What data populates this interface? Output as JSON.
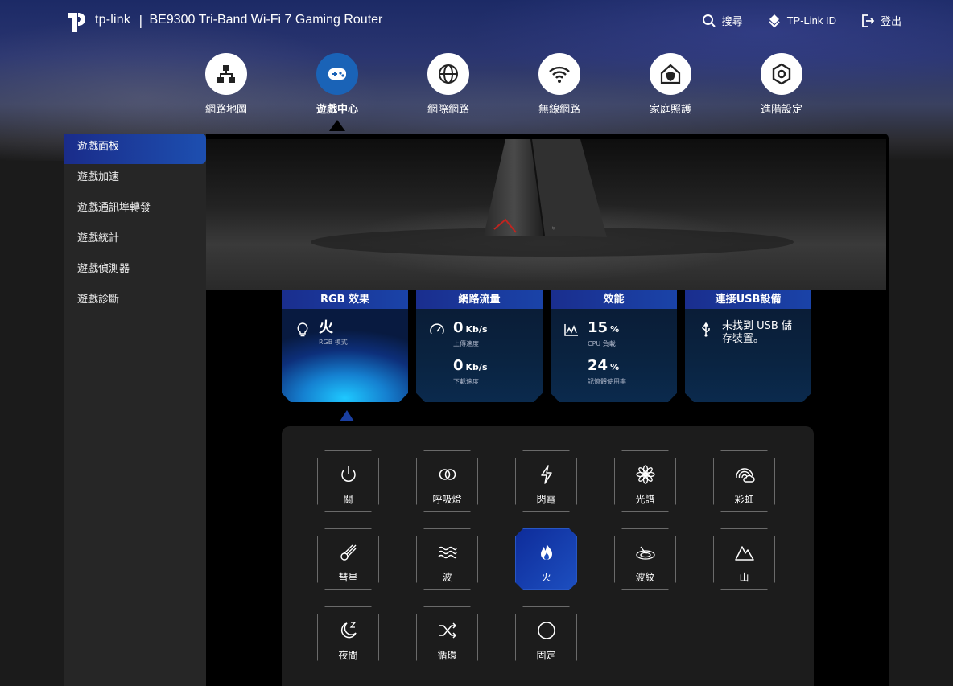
{
  "header": {
    "brand": "tp-link",
    "separator": "|",
    "model": "BE9300 Tri-Band Wi-Fi 7 Gaming Router",
    "actions": [
      {
        "label": "搜尋",
        "icon": "search-icon"
      },
      {
        "label": "TP-Link ID",
        "icon": "tplink-id-icon"
      },
      {
        "label": "登出",
        "icon": "logout-icon"
      }
    ]
  },
  "nav": {
    "items": [
      {
        "label": "網路地圖",
        "icon": "network-map-icon"
      },
      {
        "label": "遊戲中心",
        "icon": "gamepad-icon",
        "active": true
      },
      {
        "label": "網際網路",
        "icon": "globe-icon"
      },
      {
        "label": "無線網路",
        "icon": "wifi-icon"
      },
      {
        "label": "家庭照護",
        "icon": "home-shield-icon"
      },
      {
        "label": "進階設定",
        "icon": "gear-icon"
      }
    ]
  },
  "sidebar": {
    "items": [
      {
        "label": "遊戲面板",
        "active": true
      },
      {
        "label": "遊戲加速"
      },
      {
        "label": "遊戲通訊埠轉發"
      },
      {
        "label": "遊戲統計"
      },
      {
        "label": "遊戲偵測器"
      },
      {
        "label": "遊戲診斷"
      }
    ]
  },
  "cards": {
    "rgb": {
      "title": "RGB 效果",
      "value": "火",
      "label": "RGB 模式",
      "icon": "bulb-icon"
    },
    "traffic": {
      "title": "網路流量",
      "icon": "gauge-icon",
      "upload": {
        "value": "0",
        "unit": "Kb/s",
        "label": "上傳速度"
      },
      "download": {
        "value": "0",
        "unit": "Kb/s",
        "label": "下載速度"
      }
    },
    "performance": {
      "title": "效能",
      "icon": "chart-icon",
      "cpu": {
        "value": "15",
        "unit": "%",
        "label": "CPU 負載"
      },
      "memory": {
        "value": "24",
        "unit": "%",
        "label": "記憶體使用率"
      }
    },
    "usb": {
      "title": "連接USB設備",
      "icon": "usb-icon",
      "text": "未找到 USB 儲存裝置。"
    }
  },
  "effects": [
    {
      "label": "關",
      "icon": "power-icon"
    },
    {
      "label": "呼吸燈",
      "icon": "breathing-icon"
    },
    {
      "label": "閃電",
      "icon": "lightning-icon"
    },
    {
      "label": "光譜",
      "icon": "spectrum-icon"
    },
    {
      "label": "彩虹",
      "icon": "rainbow-icon"
    },
    {
      "label": "彗星",
      "icon": "comet-icon"
    },
    {
      "label": "波",
      "icon": "wave-icon"
    },
    {
      "label": "火",
      "icon": "fire-icon",
      "active": true
    },
    {
      "label": "波紋",
      "icon": "ripple-icon"
    },
    {
      "label": "山",
      "icon": "mountain-icon"
    },
    {
      "label": "夜間",
      "icon": "night-icon"
    },
    {
      "label": "循環",
      "icon": "shuffle-icon"
    },
    {
      "label": "固定",
      "icon": "circle-icon"
    }
  ],
  "colors": {
    "accent": "#1a63b7",
    "card_header": "#1a2e8e",
    "active_effect": "#1d4fc0"
  }
}
